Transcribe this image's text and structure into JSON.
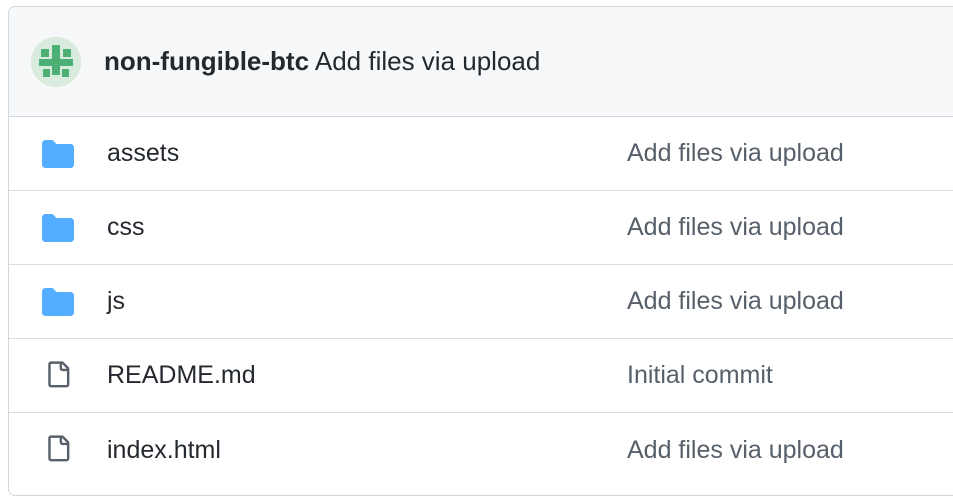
{
  "latest_commit": {
    "author": "non-fungible-btc",
    "message": "Add files via upload"
  },
  "files": [
    {
      "type": "folder",
      "icon": "folder-icon",
      "name": "assets",
      "commit_message": "Add files via upload"
    },
    {
      "type": "folder",
      "icon": "folder-icon",
      "name": "css",
      "commit_message": "Add files via upload"
    },
    {
      "type": "folder",
      "icon": "folder-icon",
      "name": "js",
      "commit_message": "Add files via upload"
    },
    {
      "type": "file",
      "icon": "file-icon",
      "name": "README.md",
      "commit_message": "Initial commit"
    },
    {
      "type": "file",
      "icon": "file-icon",
      "name": "index.html",
      "commit_message": "Add files via upload"
    }
  ],
  "colors": {
    "folder": "#54aeff",
    "file": "#57606a",
    "header_bg": "#f6f8fa",
    "border": "#d0d7de",
    "avatar_bg": "#d8ebdc",
    "avatar_fg": "#4caf75"
  }
}
